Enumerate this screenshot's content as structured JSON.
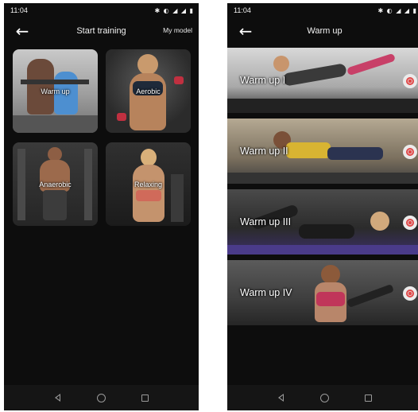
{
  "status": {
    "time": "11:04",
    "icons": "✱ ◐ ◢ ◢ ▮"
  },
  "screens": [
    {
      "title": "Start training",
      "action_label": "My model",
      "back_icon": "arrow-left-icon",
      "tiles": [
        {
          "label": "Warm up"
        },
        {
          "label": "Aerobic"
        },
        {
          "label": "Anaerobic"
        },
        {
          "label": "Relaxing"
        }
      ]
    },
    {
      "title": "Warm up",
      "back_icon": "arrow-left-icon",
      "rows": [
        {
          "label": "Warm up I",
          "icon": "target-icon"
        },
        {
          "label": "Warm up II",
          "icon": "target-icon"
        },
        {
          "label": "Warm up III",
          "icon": "target-icon"
        },
        {
          "label": "Warm up IV",
          "icon": "target-icon"
        }
      ]
    }
  ],
  "nav": {
    "icons": [
      "nav-back-icon",
      "nav-home-icon",
      "nav-recents-icon"
    ]
  },
  "colors": {
    "background": "#0d0d0d",
    "target_accent": "#e04848",
    "navbar": "#151515"
  }
}
